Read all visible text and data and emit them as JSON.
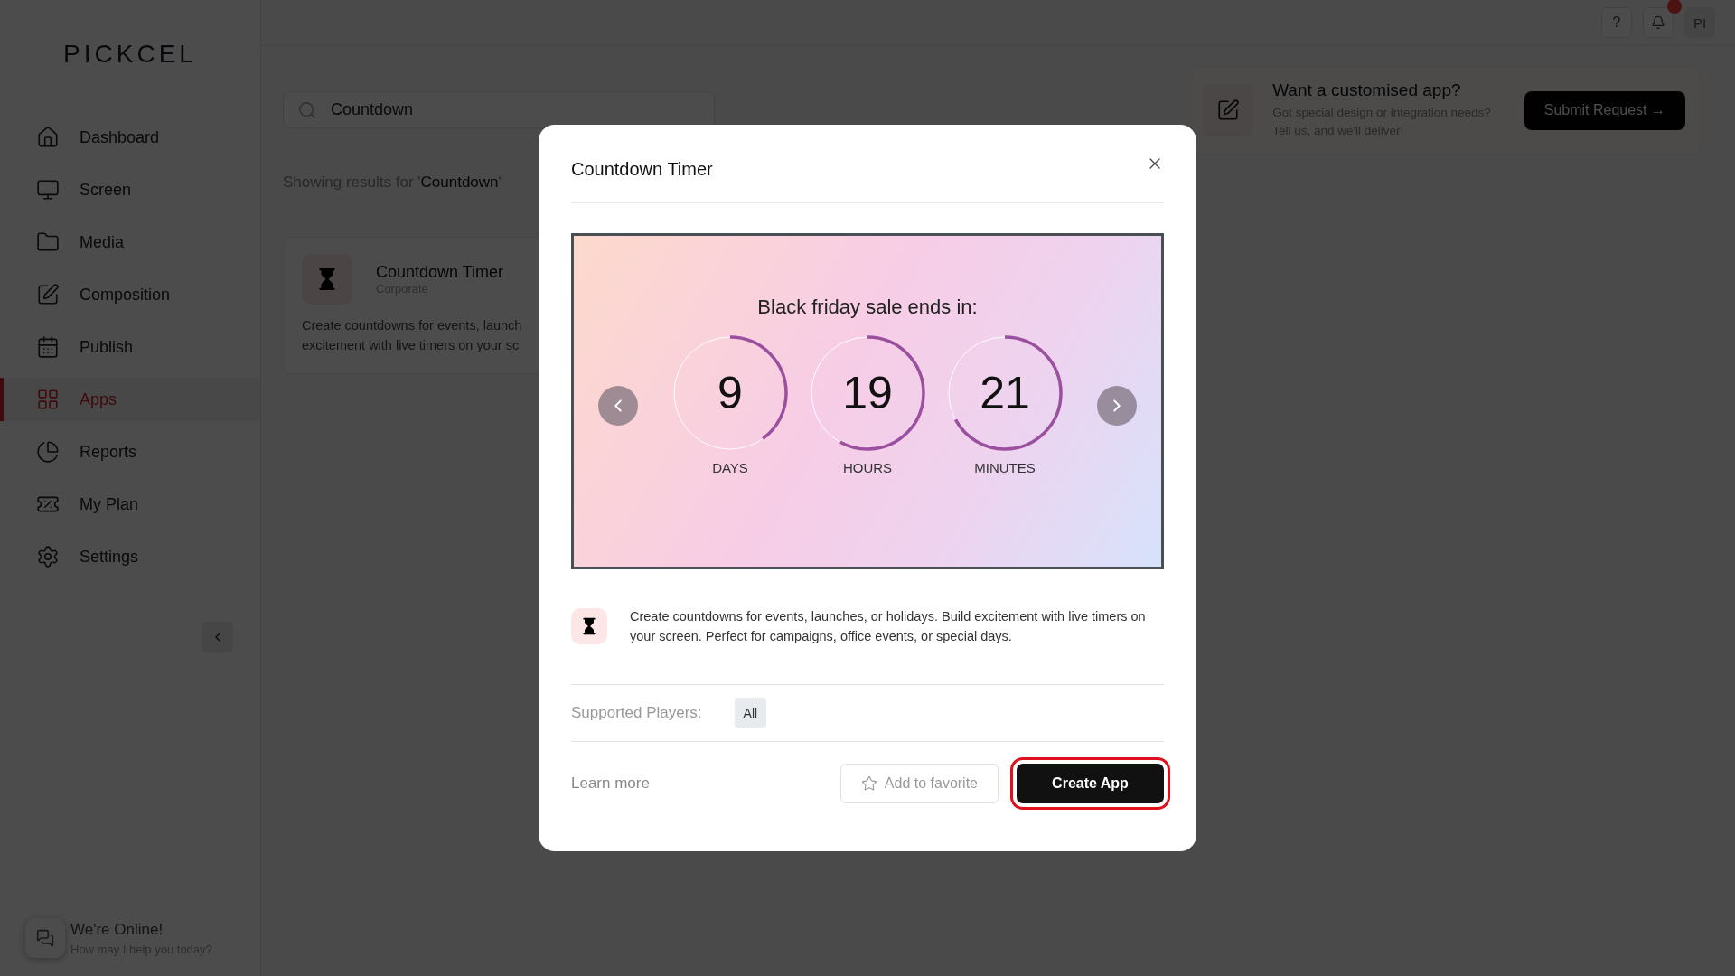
{
  "brand": {
    "logo": "PICKCEL"
  },
  "sidebar": {
    "items": [
      {
        "label": "Dashboard",
        "selected": false
      },
      {
        "label": "Screen",
        "selected": false
      },
      {
        "label": "Media",
        "selected": false
      },
      {
        "label": "Composition",
        "selected": false
      },
      {
        "label": "Publish",
        "selected": false
      },
      {
        "label": "Apps",
        "selected": true
      },
      {
        "label": "Reports",
        "selected": false
      },
      {
        "label": "My Plan",
        "selected": false
      },
      {
        "label": "Settings",
        "selected": false
      }
    ]
  },
  "chat": {
    "title": "We're Online!",
    "subtitle": "How may I help you today?"
  },
  "topbar": {
    "help": "?",
    "notifications_unread": true,
    "avatar": "PI"
  },
  "search": {
    "value": "Countdown"
  },
  "results_text": "Showing results for '**Countdown**'",
  "app_card": {
    "title": "Countdown Timer",
    "category": "Corporate",
    "description_lines": [
      "Create countdowns for events, launch",
      "excitement with live timers on your sc"
    ]
  },
  "promo": {
    "title": "Want a customised app?",
    "text": "Got special design or integration needs? Tell us, and we'll deliver!",
    "button": "Submit Request →"
  },
  "modal": {
    "title": "Countdown Timer",
    "preview": {
      "heading": "Black friday sale ends in:",
      "units": [
        {
          "value": "9",
          "label": "DAYS",
          "level": 0.4
        },
        {
          "value": "19",
          "label": "HOURS",
          "level": 0.58
        },
        {
          "value": "21",
          "label": "MINUTES",
          "level": 0.67
        }
      ]
    },
    "description": "Create countdowns for events, launches, or holidays. Build excitement with live timers on your screen. Perfect for campaigns, office events, or special days.",
    "supported_label": "Supported Players:",
    "players": [
      "All"
    ],
    "learn_more": "Learn more",
    "favorite_button": "Add to favorite",
    "create_button": "Create App",
    "create_highlighted": true
  }
}
